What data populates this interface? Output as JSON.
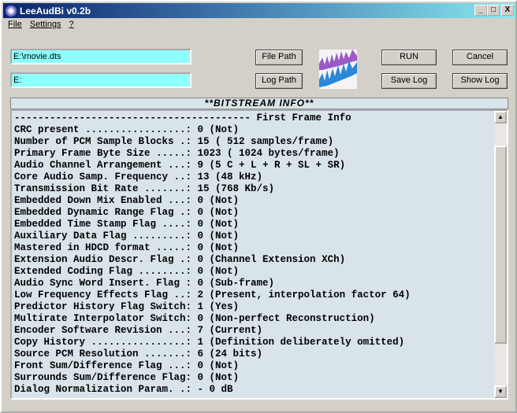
{
  "window": {
    "title": "LeeAudBi v0.2b",
    "minimize": "_",
    "maximize": "□",
    "close": "X"
  },
  "menu": [
    "File",
    "Settings",
    "?"
  ],
  "inputs": {
    "file_path": "E:\\movie.dts",
    "log_path": "E:"
  },
  "buttons": {
    "file_path": "File Path",
    "log_path": "Log Path",
    "run": "RUN",
    "cancel": "Cancel",
    "save_log": "Save Log",
    "show_log": "Show Log"
  },
  "panel": {
    "title": "**BITSTREAM INFO**",
    "lines": [
      "---------------------------------------- First Frame Info",
      "CRC present .................: 0 (Not)",
      "Number of PCM Sample Blocks .: 15 ( 512 samples/frame)",
      "Primary Frame Byte Size .....: 1023 ( 1024 bytes/frame)",
      "Audio Channel Arrangement ...: 9 (5 C + L + R + SL + SR)",
      "Core Audio Samp. Frequency ..: 13 (48 kHz)",
      "Transmission Bit Rate .......: 15 (768 Kb/s)",
      "Embedded Down Mix Enabled ...: 0 (Not)",
      "Embedded Dynamic Range Flag .: 0 (Not)",
      "Embedded Time Stamp Flag ....: 0 (Not)",
      "Auxiliary Data Flag .........: 0 (Not)",
      "Mastered in HDCD format .....: 0 (Not)",
      "Extension Audio Descr. Flag .: 0 (Channel Extension XCh)",
      "Extended Coding Flag ........: 0 (Not)",
      "Audio Sync Word Insert. Flag : 0 (Sub-frame)",
      "Low Frequency Effects Flag ..: 2 (Present, interpolation factor 64)",
      "Predictor History Flag Switch: 1 (Yes)",
      "Multirate Interpolator Switch: 0 (Non-perfect Reconstruction)",
      "Encoder Software Revision ...: 7 (Current)",
      "Copy History ................: 1 (Definition deliberately omitted)",
      "Source PCM Resolution .......: 6 (24 bits)",
      "Front Sum/Difference Flag ...: 0 (Not)",
      "Surrounds Sum/Difference Flag: 0 (Not)",
      "Dialog Normalization Param. .: - 0 dB"
    ]
  },
  "scrollbar": {
    "up": "▲",
    "down": "▼"
  }
}
